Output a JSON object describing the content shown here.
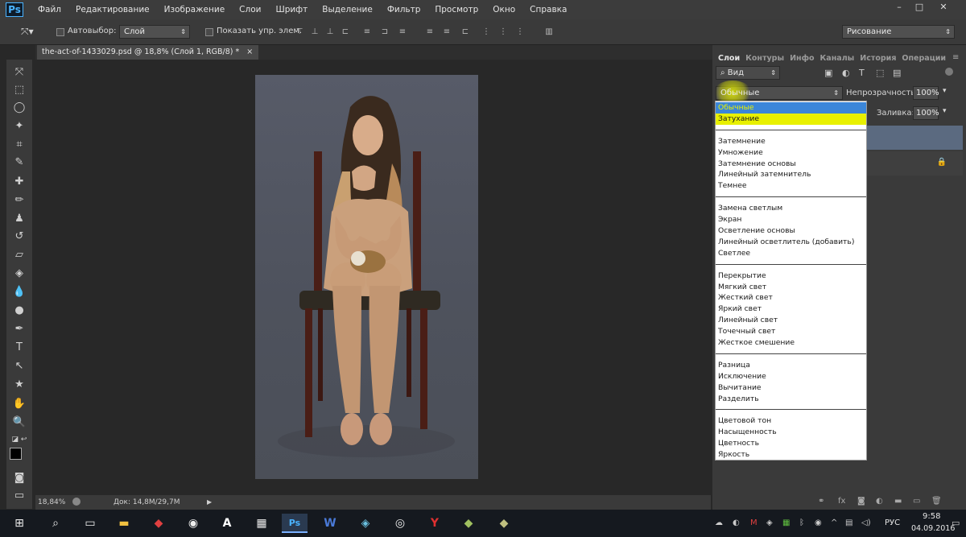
{
  "app": {
    "logo": "Ps",
    "menu": [
      "Файл",
      "Редактирование",
      "Изображение",
      "Слои",
      "Шрифт",
      "Выделение",
      "Фильтр",
      "Просмотр",
      "Окно",
      "Справка"
    ],
    "window_controls": [
      "–",
      "□",
      "✕"
    ]
  },
  "options_bar": {
    "autoselect_label": "Автовыбор:",
    "autoselect_value": "Слой",
    "show_controls_label": "Показать упр. элем.",
    "workspace_value": "Рисование"
  },
  "document_tab": {
    "title": "the-act-of-1433029.psd @ 18,8% (Слой 1, RGB/8) *",
    "close": "×"
  },
  "status": {
    "zoom": "18,84%",
    "doc_size": "Док: 14,8M/29,7M"
  },
  "layers_panel": {
    "tabs": [
      "Слои",
      "Контуры",
      "Инфо",
      "Каналы",
      "История",
      "Операции"
    ],
    "filter_label": "Вид",
    "blend_mode_value": "Обычные",
    "opacity_label": "Непрозрачность:",
    "opacity_value": "100%",
    "fill_label": "Заливка:",
    "fill_value": "100%"
  },
  "blend_menu": {
    "groups": [
      [
        "Обычные",
        "Затухание"
      ],
      [
        "Затемнение",
        "Умножение",
        "Затемнение основы",
        "Линейный затемнитель",
        "Темнее"
      ],
      [
        "Замена светлым",
        "Экран",
        "Осветление основы",
        "Линейный осветлитель (добавить)",
        "Светлее"
      ],
      [
        "Перекрытие",
        "Мягкий свет",
        "Жесткий свет",
        "Яркий свет",
        "Линейный свет",
        "Точечный свет",
        "Жесткое смешение"
      ],
      [
        "Разница",
        "Исключение",
        "Вычитание",
        "Разделить"
      ],
      [
        "Цветовой тон",
        "Насыщенность",
        "Цветность",
        "Яркость"
      ]
    ]
  },
  "taskbar": {
    "language": "РУС",
    "time": "9:58",
    "date": "04.09.2016"
  },
  "colors": {
    "accent_selected": "#3b86d9",
    "highlight_yellow": "#e8f000"
  }
}
